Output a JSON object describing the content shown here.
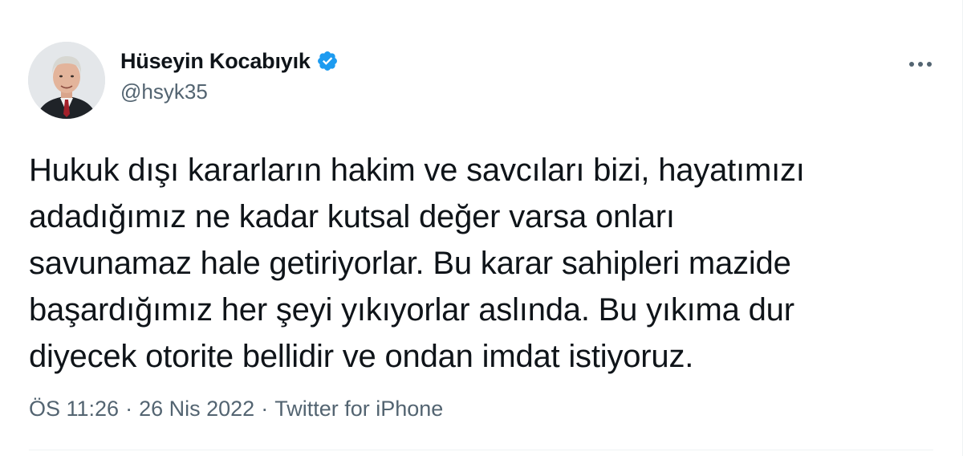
{
  "author": {
    "display_name": "Hüseyin Kocabıyık",
    "handle": "@hsyk35",
    "verified": true,
    "verified_color": "#1d9bf0"
  },
  "tweet": {
    "text_lines": [
      "Hukuk dışı kararların hakim ve savcıları bizi, hayatımızı",
      "adadığımız ne kadar kutsal değer varsa onları",
      "savunamaz hale getiriyorlar. Bu karar sahipleri mazide",
      "başardığımız her şeyi yıkıyorlar aslında. Bu yıkıma dur",
      "diyecek otorite bellidir ve ondan imdat istiyoruz."
    ]
  },
  "meta": {
    "time": "ÖS 11:26",
    "separator": "·",
    "date": "26 Nis 2022",
    "source": "Twitter for iPhone"
  },
  "icons": {
    "verified": "verified-badge-icon",
    "more": "more-horizontal-icon"
  },
  "colors": {
    "text_primary": "#0f1419",
    "text_secondary": "#536471",
    "accent": "#1d9bf0"
  }
}
